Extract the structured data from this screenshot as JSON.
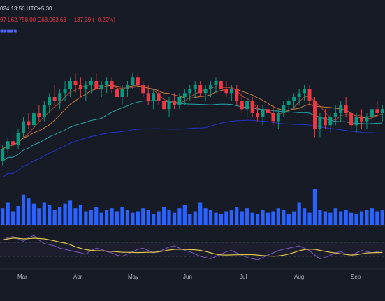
{
  "header": {
    "datetime": "024 13:56 UTC+5:30"
  },
  "ohlc": {
    "open_fragment": "97",
    "low": "L62,758.00",
    "close": "C63,063.66",
    "change": "−137.39 (−0.22%)"
  },
  "indicator_legend": {
    "text": "■■■■■"
  },
  "x_axis": {
    "months": [
      "Mar",
      "Apr",
      "May",
      "Jun",
      "Jul",
      "Aug",
      "Sep"
    ]
  },
  "colors": {
    "background": "#171b26",
    "up": "#089981",
    "down": "#f23645",
    "volume": "#2962ff",
    "ma_red": "#b5452f",
    "ma_orange": "#c37b3b",
    "ma_teal": "#22a7a7",
    "ma_blue": "#2433c9",
    "rsi": "#7e57c2",
    "rsi_ma": "#e0c84a"
  },
  "chart_data": {
    "type": "candlestick",
    "title": "",
    "xlabel": "",
    "ylabel": "",
    "x": [
      "Mar",
      "Apr",
      "May",
      "Jun",
      "Jul",
      "Aug",
      "Sep"
    ],
    "series": [
      {
        "candles": [
          [
            52,
            56,
            51,
            55
          ],
          [
            55,
            58,
            54,
            57
          ],
          [
            57,
            59,
            55,
            56
          ],
          [
            56,
            60,
            55,
            59
          ],
          [
            59,
            63,
            58,
            62
          ],
          [
            62,
            64,
            60,
            61
          ],
          [
            61,
            65,
            60,
            64
          ],
          [
            64,
            66,
            62,
            63
          ],
          [
            63,
            67,
            62,
            66
          ],
          [
            66,
            69,
            64,
            68
          ],
          [
            68,
            71,
            66,
            67
          ],
          [
            67,
            70,
            65,
            69
          ],
          [
            69,
            72,
            67,
            70
          ],
          [
            70,
            73,
            68,
            72
          ],
          [
            72,
            74,
            69,
            71
          ],
          [
            71,
            73,
            68,
            70
          ],
          [
            70,
            72,
            67,
            71
          ],
          [
            71,
            73,
            69,
            72
          ],
          [
            72,
            74,
            70,
            70
          ],
          [
            70,
            72,
            68,
            71
          ],
          [
            71,
            73,
            69,
            72
          ],
          [
            72,
            73,
            69,
            70
          ],
          [
            70,
            72,
            67,
            68
          ],
          [
            68,
            71,
            66,
            70
          ],
          [
            70,
            72,
            68,
            71
          ],
          [
            71,
            74,
            70,
            73
          ],
          [
            73,
            74,
            70,
            71
          ],
          [
            71,
            72,
            68,
            69
          ],
          [
            69,
            71,
            66,
            67
          ],
          [
            67,
            70,
            65,
            69
          ],
          [
            69,
            70,
            66,
            67
          ],
          [
            67,
            69,
            64,
            65
          ],
          [
            65,
            68,
            63,
            67
          ],
          [
            67,
            69,
            65,
            66
          ],
          [
            66,
            69,
            65,
            68
          ],
          [
            68,
            70,
            66,
            69
          ],
          [
            69,
            71,
            67,
            70
          ],
          [
            70,
            72,
            68,
            71
          ],
          [
            71,
            72,
            68,
            69
          ],
          [
            69,
            71,
            67,
            70
          ],
          [
            70,
            72,
            68,
            71
          ],
          [
            71,
            73,
            69,
            72
          ],
          [
            72,
            73,
            69,
            70
          ],
          [
            70,
            72,
            68,
            69
          ],
          [
            69,
            71,
            67,
            70
          ],
          [
            70,
            71,
            66,
            67
          ],
          [
            67,
            69,
            64,
            65
          ],
          [
            65,
            68,
            63,
            67
          ],
          [
            67,
            68,
            63,
            64
          ],
          [
            64,
            66,
            62,
            63
          ],
          [
            63,
            66,
            61,
            65
          ],
          [
            65,
            67,
            63,
            64
          ],
          [
            64,
            66,
            61,
            62
          ],
          [
            62,
            65,
            60,
            64
          ],
          [
            64,
            67,
            63,
            66
          ],
          [
            66,
            68,
            64,
            67
          ],
          [
            67,
            69,
            65,
            68
          ],
          [
            68,
            70,
            66,
            69
          ],
          [
            69,
            71,
            67,
            70
          ],
          [
            70,
            71,
            66,
            67
          ],
          [
            67,
            68,
            58,
            60
          ],
          [
            60,
            64,
            58,
            63
          ],
          [
            63,
            65,
            60,
            61
          ],
          [
            61,
            64,
            59,
            63
          ],
          [
            63,
            66,
            61,
            64
          ],
          [
            64,
            67,
            62,
            66
          ],
          [
            66,
            68,
            63,
            64
          ],
          [
            64,
            65,
            60,
            61
          ],
          [
            61,
            64,
            59,
            63
          ],
          [
            63,
            65,
            60,
            62
          ],
          [
            62,
            64,
            60,
            63
          ],
          [
            63,
            66,
            61,
            65
          ],
          [
            65,
            67,
            63,
            64
          ],
          [
            64,
            66,
            62,
            65
          ]
        ]
      }
    ],
    "volume": [
      22,
      30,
      18,
      25,
      40,
      35,
      28,
      22,
      30,
      26,
      20,
      24,
      28,
      32,
      22,
      26,
      18,
      20,
      24,
      16,
      20,
      22,
      18,
      24,
      20,
      16,
      18,
      22,
      20,
      14,
      18,
      24,
      20,
      16,
      22,
      26,
      14,
      18,
      30,
      22,
      20,
      16,
      14,
      18,
      20,
      24,
      18,
      22,
      16,
      14,
      20,
      16,
      18,
      22,
      20,
      14,
      18,
      30,
      22,
      16,
      48,
      20,
      18,
      16,
      22,
      18,
      20,
      16,
      14,
      18,
      20,
      22,
      18,
      20
    ],
    "rsi": [
      66,
      70,
      72,
      68,
      64,
      70,
      74,
      66,
      60,
      58,
      56,
      52,
      50,
      48,
      46,
      44,
      42,
      48,
      52,
      50,
      46,
      44,
      40,
      38,
      42,
      46,
      50,
      52,
      48,
      44,
      46,
      50,
      54,
      56,
      52,
      48,
      46,
      42,
      38,
      36,
      34,
      38,
      42,
      46,
      48,
      44,
      40,
      36,
      34,
      32,
      36,
      40,
      44,
      48,
      50,
      52,
      54,
      56,
      52,
      48,
      40,
      34,
      36,
      40,
      44,
      46,
      42,
      40,
      44,
      48,
      46,
      44,
      46,
      48
    ],
    "ylim": [
      40,
      80
    ]
  }
}
